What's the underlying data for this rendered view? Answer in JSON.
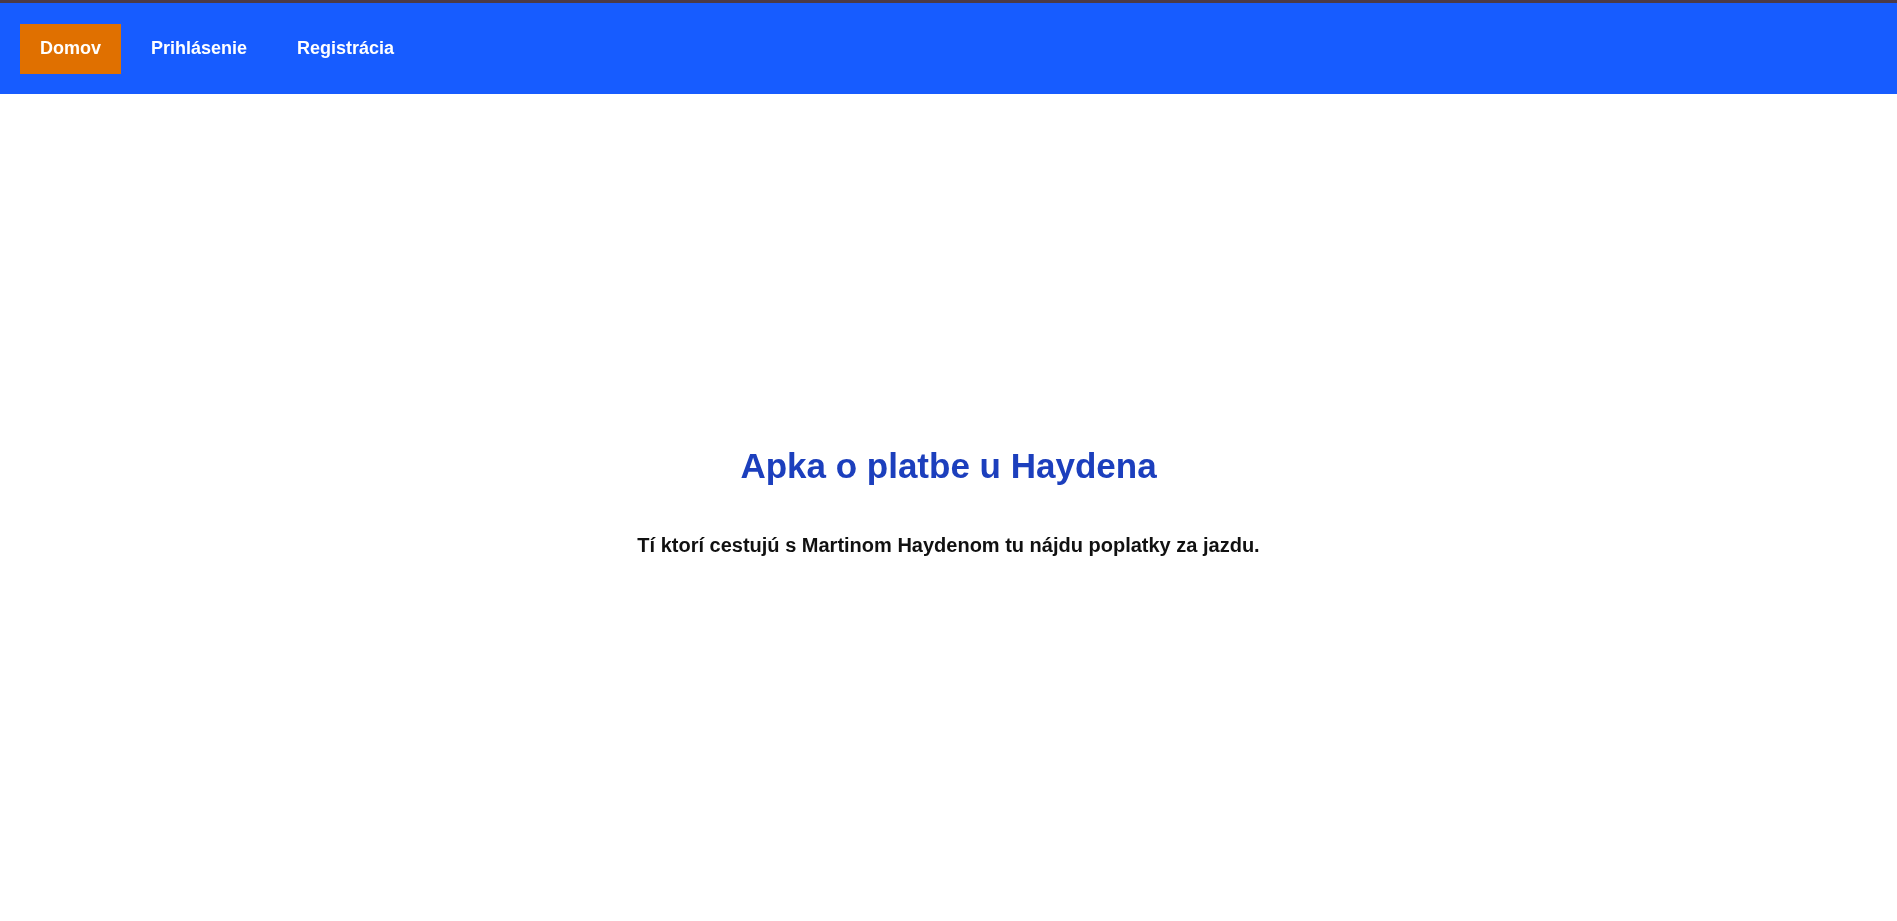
{
  "nav": {
    "items": [
      {
        "label": "Domov",
        "selected": true
      },
      {
        "label": "Prihlásenie",
        "selected": false
      },
      {
        "label": "Registrácia",
        "selected": false
      }
    ]
  },
  "hero": {
    "title": "Apka o platbe u Haydena",
    "subtitle": "Tí ktorí cestujú s Martinom Haydenom tu nájdu poplatky za jazdu."
  }
}
